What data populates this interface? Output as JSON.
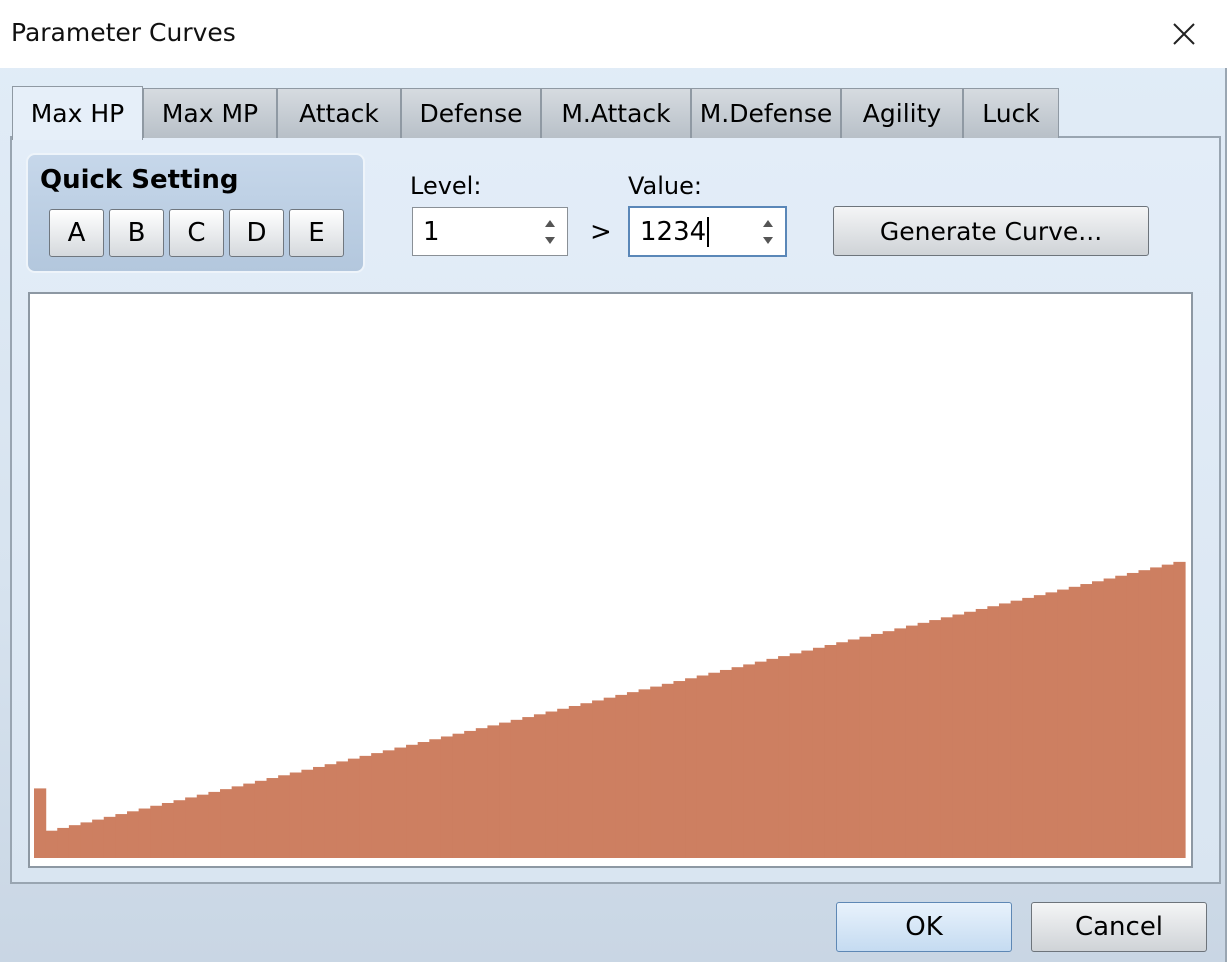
{
  "window": {
    "title": "Parameter Curves"
  },
  "tabs": [
    {
      "label": "Max HP",
      "active": true
    },
    {
      "label": "Max MP",
      "active": false
    },
    {
      "label": "Attack",
      "active": false
    },
    {
      "label": "Defense",
      "active": false
    },
    {
      "label": "M.Attack",
      "active": false
    },
    {
      "label": "M.Defense",
      "active": false
    },
    {
      "label": "Agility",
      "active": false
    },
    {
      "label": "Luck",
      "active": false
    }
  ],
  "quick_setting": {
    "title": "Quick Setting",
    "buttons": [
      "A",
      "B",
      "C",
      "D",
      "E"
    ]
  },
  "level": {
    "label": "Level:",
    "value": "1"
  },
  "separator": ">",
  "value_field": {
    "label": "Value:",
    "value": "1234"
  },
  "generate_button": "Generate Curve...",
  "chart_data": {
    "type": "area",
    "color": "#cd7f61",
    "highlight_level": 1,
    "highlight_value": 1234,
    "level_range": [
      1,
      99
    ],
    "curve_start_value": 484,
    "curve_end_value": 5250,
    "y_max": 9999
  },
  "footer": {
    "ok": "OK",
    "cancel": "Cancel"
  }
}
